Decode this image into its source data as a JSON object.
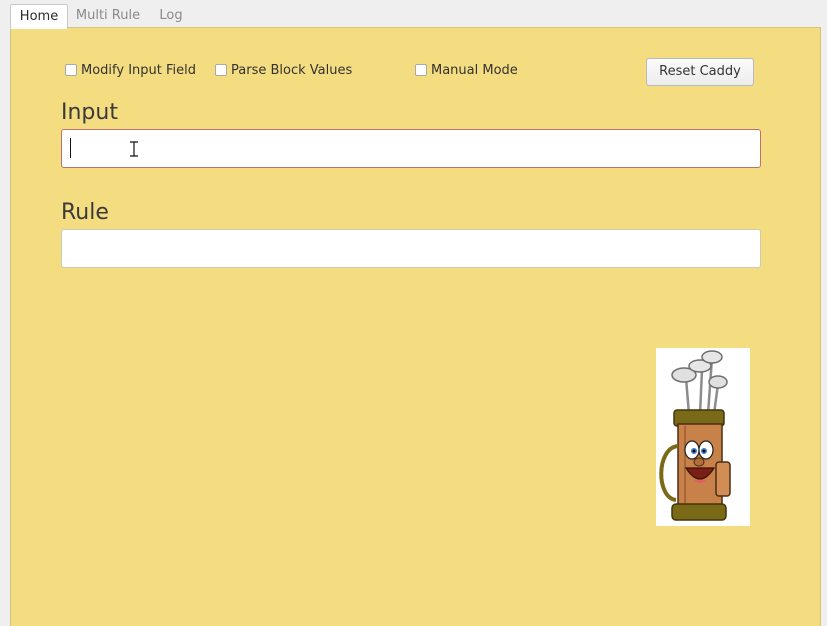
{
  "tabs": [
    {
      "label": "Home",
      "active": true
    },
    {
      "label": "Multi Rule",
      "active": false
    },
    {
      "label": "Log",
      "active": false
    }
  ],
  "options": {
    "modify_input_field": {
      "label": "Modify Input Field",
      "checked": false
    },
    "parse_block_values": {
      "label": "Parse Block Values",
      "checked": false
    },
    "manual_mode": {
      "label": "Manual Mode",
      "checked": false
    }
  },
  "reset_button_label": "Reset Caddy",
  "input": {
    "label": "Input",
    "value": ""
  },
  "rule": {
    "label": "Rule",
    "value": ""
  },
  "colors": {
    "panel_background": "#f4dc80",
    "focused_border": "#b8746a"
  },
  "icons": {
    "mascot": "golf-bag-mascot-icon",
    "cursor": "text-cursor-icon"
  }
}
